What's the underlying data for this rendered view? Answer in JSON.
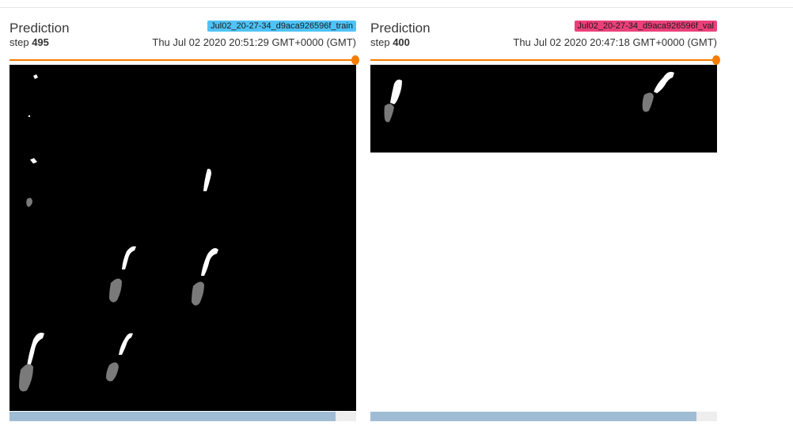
{
  "cards": [
    {
      "title": "Prediction",
      "run_tag": "Jul02_20-27-34_d9aca926596f_train",
      "run_color": "#4fc3f7",
      "step_label": "step",
      "step_value": "495",
      "timestamp": "Thu Jul 02 2020 20:51:29 GMT+0000 (GMT)",
      "scroll_fraction": 0.94
    },
    {
      "title": "Prediction",
      "run_tag": "Jul02_20-27-34_d9aca926596f_val",
      "run_color": "#ec407a",
      "step_label": "step",
      "step_value": "400",
      "timestamp": "Thu Jul 02 2020 20:47:18 GMT+0000 (GMT)",
      "scroll_fraction": 0.94
    }
  ],
  "colors": {
    "accent": "#f57c00",
    "image_background": "#000000",
    "mask_foreground": "#ffffff",
    "mask_secondary": "#7a7a7a",
    "scrollbar": "#9fbcd4"
  }
}
